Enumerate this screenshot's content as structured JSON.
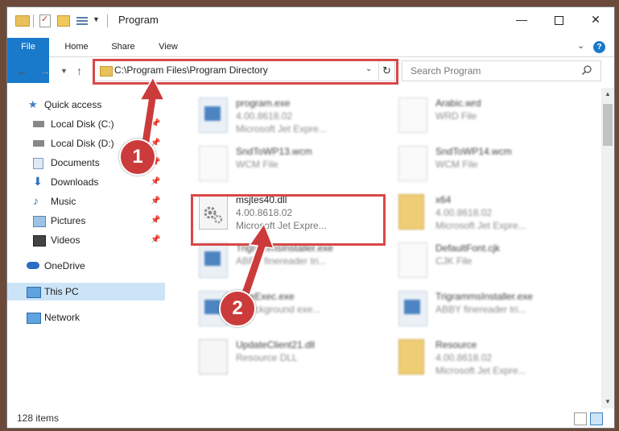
{
  "window": {
    "title": "Program"
  },
  "ribbon": {
    "tabs": [
      "File",
      "Home",
      "Share",
      "View"
    ]
  },
  "address": {
    "path": "C:\\Program Files\\Program Directory",
    "search_placeholder": "Search Program"
  },
  "nav_pane": {
    "quick_access": "Quick access",
    "items": [
      {
        "label": "Local Disk (C:)",
        "icon": "drive-icon",
        "pinned": true
      },
      {
        "label": "Local Disk (D:)",
        "icon": "drive-icon",
        "pinned": true
      },
      {
        "label": "Documents",
        "icon": "documents-icon",
        "pinned": true
      },
      {
        "label": "Downloads",
        "icon": "downloads-icon",
        "pinned": true
      },
      {
        "label": "Music",
        "icon": "music-icon",
        "pinned": true
      },
      {
        "label": "Pictures",
        "icon": "pictures-icon",
        "pinned": true
      },
      {
        "label": "Videos",
        "icon": "videos-icon",
        "pinned": true
      }
    ],
    "onedrive": "OneDrive",
    "this_pc": "This PC",
    "network": "Network"
  },
  "files": [
    {
      "name": "program.exe",
      "line1": "4.00.8618.02",
      "line2": "Microsoft Jet Expre...",
      "icon": "exe",
      "blurred": true
    },
    {
      "name": "Arabic.wrd",
      "line1": "WRD File",
      "line2": "",
      "icon": "doc",
      "blurred": true
    },
    {
      "name": "SndToWP13.wcm",
      "line1": "WCM File",
      "line2": "",
      "icon": "doc",
      "blurred": true
    },
    {
      "name": "SndToWP14.wcm",
      "line1": "WCM File",
      "line2": "",
      "icon": "doc",
      "blurred": true
    },
    {
      "name": "msjtes40.dll",
      "line1": "4.00.8618.02",
      "line2": "Microsoft Jet Expre...",
      "icon": "dll",
      "blurred": false
    },
    {
      "name": "x64",
      "line1": "4.00.8618.02",
      "line2": "Microsoft Jet Expre...",
      "icon": "folder",
      "blurred": true
    },
    {
      "name": "TrigrammsInstaller.exe",
      "line1": "ABBY finereader tri...",
      "line2": "",
      "icon": "exe",
      "blurred": true
    },
    {
      "name": "DefaultFont.cjk",
      "line1": "CJK File",
      "line2": "",
      "icon": "doc",
      "blurred": true
    },
    {
      "name": "FineExec.exe",
      "line1": "...background exe...",
      "line2": "",
      "icon": "exe",
      "blurred": true
    },
    {
      "name": "TrigrammsInstaller.exe",
      "line1": "ABBY finereader tri...",
      "line2": "",
      "icon": "exe",
      "blurred": true
    },
    {
      "name": "UpdateClient21.dll",
      "line1": "Resource DLL",
      "line2": "",
      "icon": "dll",
      "blurred": true
    },
    {
      "name": "Resource",
      "line1": "4.00.8618.02",
      "line2": "Microsoft Jet Expre...",
      "icon": "folder",
      "blurred": true
    }
  ],
  "status": {
    "item_count": "128 items"
  },
  "annotations": {
    "step1": "1",
    "step2": "2",
    "color": "#cc3b3b"
  }
}
